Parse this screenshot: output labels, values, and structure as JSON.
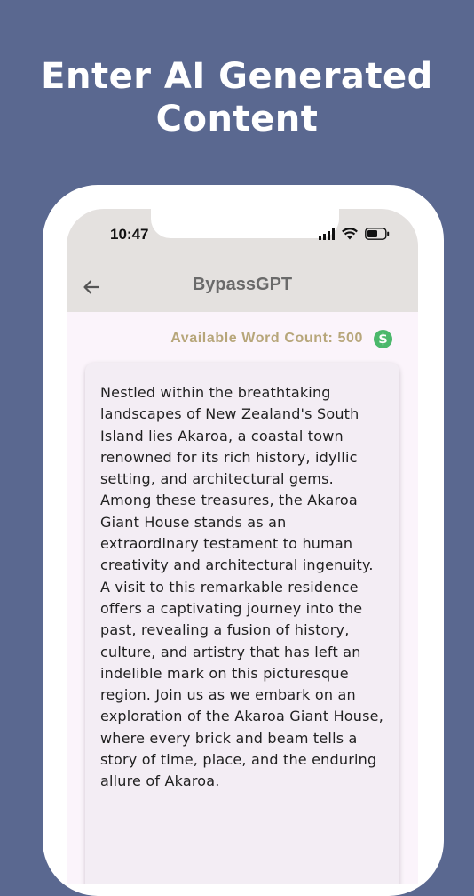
{
  "headline": "Enter AI Generated\nContent",
  "status_bar": {
    "time": "10:47",
    "icons": [
      "cellular-signal-icon",
      "wifi-icon",
      "battery-icon"
    ]
  },
  "app_bar": {
    "back_icon": "arrow-left-icon",
    "title": "BypassGPT"
  },
  "word_count": {
    "label": "Available Word Count: 500",
    "icon": "dollar-circle-icon",
    "icon_glyph": "$"
  },
  "editor": {
    "text": "Nestled within the breathtaking\nlandscapes of New Zealand's South\nIsland lies Akaroa, a coastal town\nrenowned for its rich history, idyllic\nsetting, and architectural gems.\nAmong these treasures, the Akaroa\nGiant House stands as an\nextraordinary testament to human\ncreativity and architectural ingenuity.\nA visit to this remarkable residence\noffers a captivating journey into the\npast, revealing a fusion of history,\nculture, and artistry that has left an\nindelible mark on this picturesque\nregion. Join us as we embark on an\nexploration of the Akaroa Giant House,\nwhere every brick and beam tells a\nstory of time, place, and the enduring\nallure of Akaroa."
  },
  "colors": {
    "background": "#5a6890",
    "app_bar": "#e4e1df",
    "screen": "#fbf4fb",
    "card": "#f3edf4",
    "word_count": "#b7a67a",
    "dollar_badge": "#4bb86b"
  }
}
